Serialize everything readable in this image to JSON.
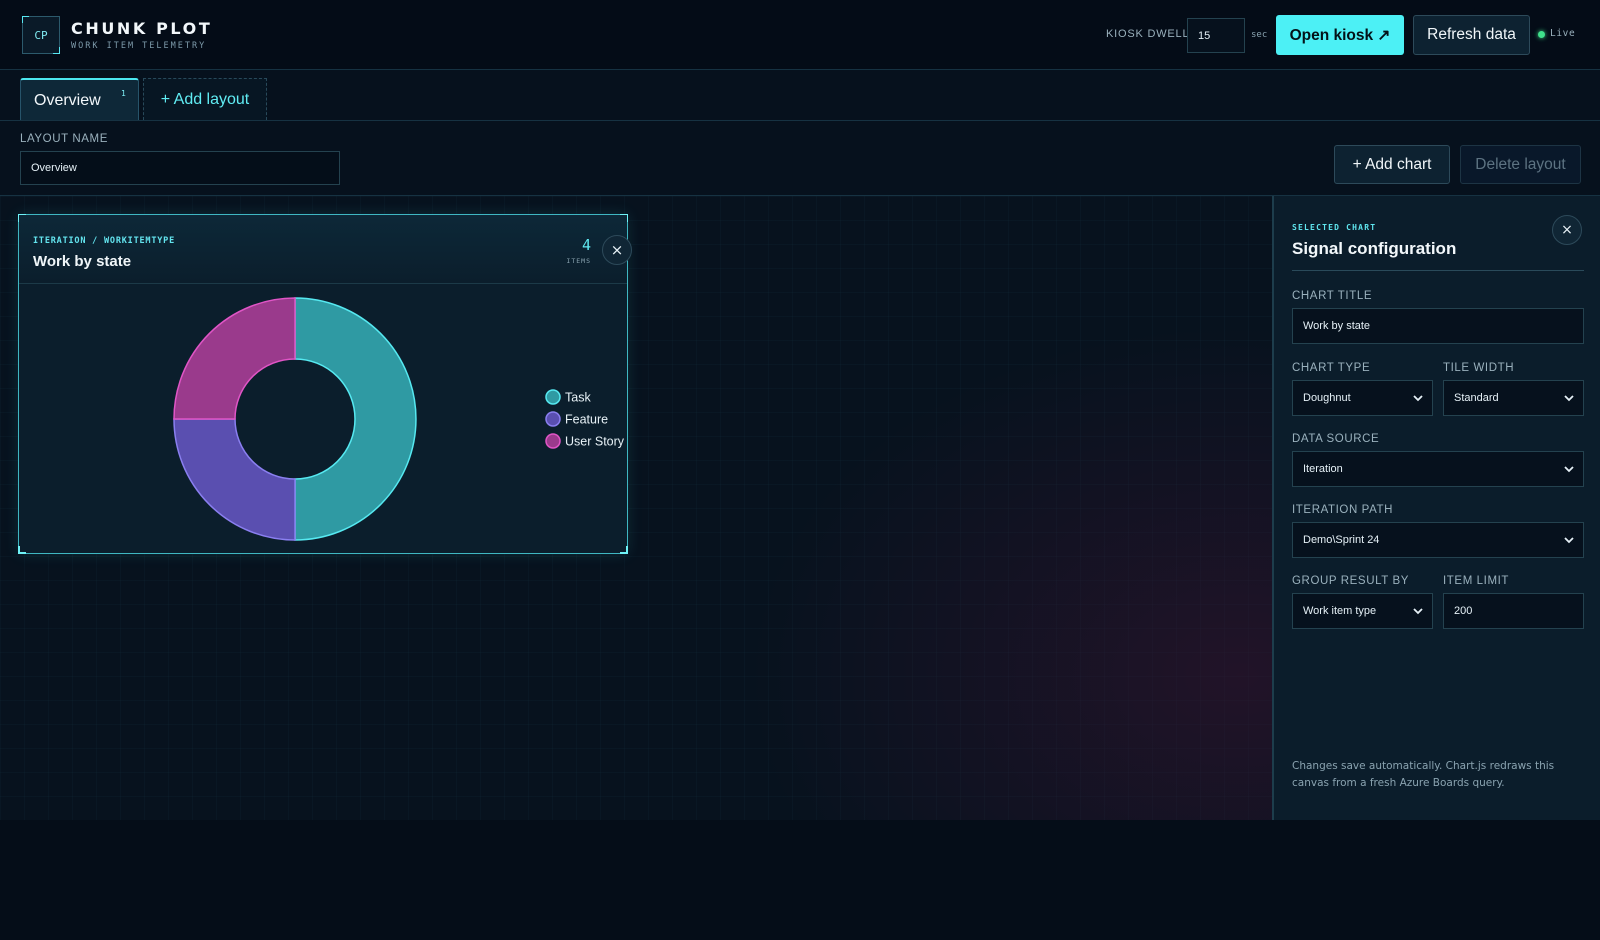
{
  "header": {
    "logo_text": "CP",
    "app_title": "CHUNK PLOT",
    "app_subtitle": "WORK ITEM TELEMETRY",
    "dwell_label": "KIOSK DWELL",
    "dwell_value": "15",
    "dwell_unit": "sec",
    "open_kiosk_label": "Open kiosk ↗",
    "refresh_label": "Refresh data",
    "live_label": "Live",
    "live_color": "#3fe08b"
  },
  "tabs": {
    "items": [
      {
        "label": "Overview",
        "count": "1"
      }
    ],
    "add_label": "+  Add layout"
  },
  "layout": {
    "name_label": "LAYOUT NAME",
    "name_value": "Overview",
    "add_chart_label": "+  Add chart",
    "delete_label": "Delete layout"
  },
  "card": {
    "kicker": "ITERATION / WORKITEMTYPE",
    "title": "Work by state",
    "count": "4",
    "count_label": "ITEMS",
    "close_icon": "×"
  },
  "chart_data": {
    "type": "pie",
    "variant": "doughnut",
    "categories": [
      "Task",
      "Feature",
      "User Story"
    ],
    "values": [
      2,
      1,
      1
    ],
    "colors": [
      "#2f9aa3",
      "#5a4fb0",
      "#9a3a8c"
    ],
    "border_colors": [
      "#56e9f1",
      "#8a7ff0",
      "#e055c6"
    ],
    "legend_position": "right"
  },
  "panel": {
    "kicker": "SELECTED CHART",
    "title": "Signal configuration",
    "close_icon": "×",
    "chart_title_label": "CHART TITLE",
    "chart_title_value": "Work by state",
    "chart_type_label": "CHART TYPE",
    "chart_type_value": "Doughnut",
    "tile_width_label": "TILE WIDTH",
    "tile_width_value": "Standard",
    "data_source_label": "DATA SOURCE",
    "data_source_value": "Iteration",
    "iteration_path_label": "ITERATION PATH",
    "iteration_path_value": "Demo\\Sprint 24",
    "group_by_label": "GROUP RESULT BY",
    "group_by_value": "Work item type",
    "item_limit_label": "ITEM LIMIT",
    "item_limit_value": "200",
    "note": "Changes save automatically. Chart.js redraws this canvas from a fresh Azure Boards query."
  },
  "colors": {
    "accent": "#4cf0f5",
    "background": "#050d18"
  }
}
